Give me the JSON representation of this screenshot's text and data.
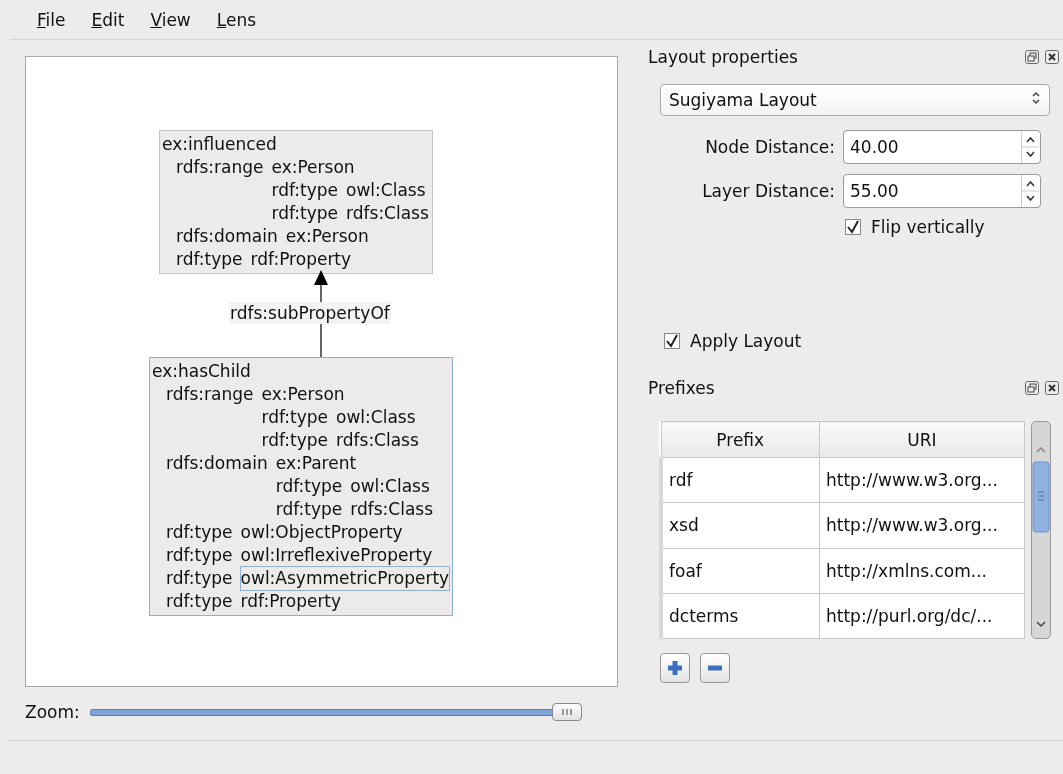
{
  "menu": [
    {
      "label": "File"
    },
    {
      "label": "Edit"
    },
    {
      "label": "View"
    },
    {
      "label": "Lens"
    }
  ],
  "graph": {
    "nodes": [
      {
        "title": "ex:influenced",
        "selected": false,
        "triples": [
          {
            "predicate": "rdfs:range",
            "object": "ex:Person",
            "selected": false,
            "children": [
              {
                "predicate": "rdf:type",
                "object": "owl:Class",
                "selected": false
              },
              {
                "predicate": "rdf:type",
                "object": "rdfs:Class",
                "selected": false
              }
            ]
          },
          {
            "predicate": "rdfs:domain",
            "object": "ex:Person",
            "selected": false
          },
          {
            "predicate": "rdf:type",
            "object": "rdf:Property",
            "selected": false
          }
        ]
      },
      {
        "title": "ex:hasChild",
        "selected": true,
        "triples": [
          {
            "predicate": "rdfs:range",
            "object": "ex:Person",
            "selected": false,
            "children": [
              {
                "predicate": "rdf:type",
                "object": "owl:Class",
                "selected": false
              },
              {
                "predicate": "rdf:type",
                "object": "rdfs:Class",
                "selected": false
              }
            ]
          },
          {
            "predicate": "rdfs:domain",
            "object": "ex:Parent",
            "selected": false,
            "children": [
              {
                "predicate": "rdf:type",
                "object": "owl:Class",
                "selected": false
              },
              {
                "predicate": "rdf:type",
                "object": "rdfs:Class",
                "selected": false
              }
            ]
          },
          {
            "predicate": "rdf:type",
            "object": "owl:ObjectProperty",
            "selected": false
          },
          {
            "predicate": "rdf:type",
            "object": "owl:IrreflexiveProperty",
            "selected": false
          },
          {
            "predicate": "rdf:type",
            "object": "owl:AsymmetricProperty",
            "selected": true
          },
          {
            "predicate": "rdf:type",
            "object": "rdf:Property",
            "selected": false
          }
        ]
      }
    ],
    "edges": [
      {
        "label": "rdfs:subPropertyOf"
      }
    ]
  },
  "zoom": {
    "label": "Zoom:",
    "level": 0.99
  },
  "layout_panel": {
    "title": "Layout properties",
    "algorithm": "Sugiyama Layout",
    "fields": [
      {
        "label": "Node Distance:",
        "value": "40.00"
      },
      {
        "label": "Layer Distance:",
        "value": "55.00"
      }
    ],
    "flip": {
      "label": "Flip vertically",
      "checked": true
    },
    "apply": {
      "label": "Apply Layout",
      "checked": true
    }
  },
  "prefixes_panel": {
    "title": "Prefixes",
    "columns": [
      "Prefix",
      "URI"
    ],
    "rows": [
      [
        "rdf",
        "http://www.w3.org..."
      ],
      [
        "xsd",
        "http://www.w3.org..."
      ],
      [
        "foaf",
        "http://xmlns.com..."
      ],
      [
        "dcterms",
        "http://purl.org/dc/..."
      ]
    ]
  }
}
